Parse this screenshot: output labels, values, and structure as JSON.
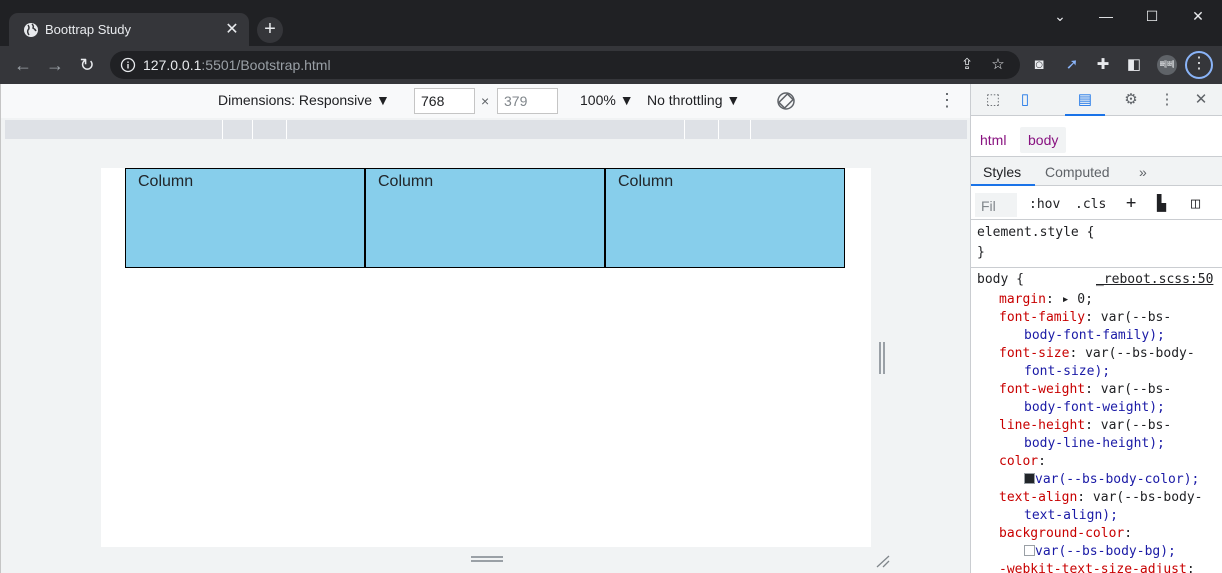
{
  "browser": {
    "tab": {
      "title": "Boottrap Study",
      "close": "✕"
    },
    "new_tab": "+",
    "window_controls": [
      "⌄",
      "—",
      "☐",
      "✕"
    ],
    "address": {
      "host": "127.0.0.1",
      "rest": ":5501/Bootstrap.html"
    },
    "profile_label": "뻬뻬"
  },
  "device_toolbar": {
    "dimensions": "Dimensions: Responsive ▼",
    "width": "768",
    "times": "×",
    "height": "379",
    "zoom": "100% ▼",
    "throttle": "No throttling ▼",
    "more": "⋮"
  },
  "page": {
    "columns": [
      "Column",
      "Column",
      "Column"
    ],
    "column_bg": "#87ceeb"
  },
  "devtools": {
    "breadcrumb": [
      "html",
      "body"
    ],
    "subtabs": {
      "styles": "Styles",
      "computed": "Computed",
      "more": "»"
    },
    "filter_placeholder": "Fil",
    "hov": ":hov",
    "cls": ".cls",
    "plus": "+",
    "element_style": "element.style {",
    "close_brace": "}",
    "rule_selector": "body {",
    "rule_source": "_reboot.scss:50",
    "decls": [
      {
        "prop": "margin",
        "value": ": ▸ 0;"
      },
      {
        "prop": "font-family",
        "value": ": var(--bs-",
        "cont": "body-font-family);"
      },
      {
        "prop": "font-size",
        "value": ": var(--bs-body-",
        "cont": "font-size);"
      },
      {
        "prop": "font-weight",
        "value": ": var(--bs-",
        "cont": "body-font-weight);"
      },
      {
        "prop": "line-height",
        "value": ": var(--bs-",
        "cont": "body-line-height);"
      },
      {
        "prop": "color",
        "value": ":",
        "cont": "var(--bs-body-color);"
      },
      {
        "prop": "text-align",
        "value": ": var(--bs-body-",
        "cont": "text-align);"
      },
      {
        "prop": "background-color",
        "value": ":",
        "cont": "var(--bs-body-bg);"
      },
      {
        "prop": "-webkit-text-size-adjust",
        "value": ":"
      }
    ]
  }
}
